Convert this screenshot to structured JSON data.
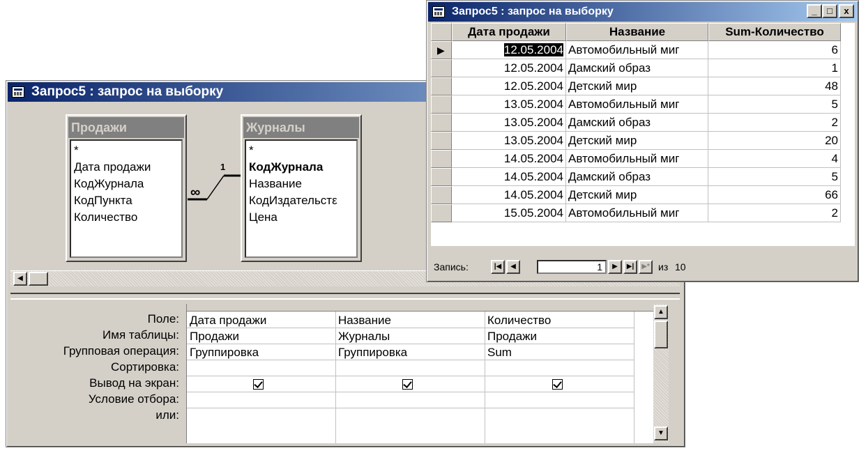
{
  "design_window": {
    "title": "Запрос5 : запрос на выборку",
    "tables": [
      {
        "name": "Продажи",
        "fields": [
          "*",
          "Дата продажи",
          "КодЖурнала",
          "КодПункта",
          "Количество"
        ]
      },
      {
        "name": "Журналы",
        "fields": [
          "*",
          "КодЖурнала",
          "Название",
          "КодИздательстε",
          "Цена"
        ]
      }
    ],
    "relationship": {
      "many": "∞",
      "one": "1"
    },
    "row_labels": {
      "field": "Поле:",
      "table": "Имя таблицы:",
      "group": "Групповая операция:",
      "sort": "Сортировка:",
      "show": "Вывод на экран:",
      "criteria": "Условие отбора:",
      "or": "или:"
    },
    "columns": [
      {
        "field": "Дата продажи",
        "table": "Продажи",
        "group": "Группировка",
        "sort": "",
        "show": true,
        "criteria": "",
        "or": ""
      },
      {
        "field": "Название",
        "table": "Журналы",
        "group": "Группировка",
        "sort": "",
        "show": true,
        "criteria": "",
        "or": ""
      },
      {
        "field": "Количество",
        "table": "Продажи",
        "group": "Sum",
        "sort": "",
        "show": true,
        "criteria": "",
        "or": ""
      }
    ]
  },
  "result_window": {
    "title": "Запрос5 : запрос на выборку",
    "buttons": {
      "minimize": "_",
      "maximize": "□",
      "close": "x"
    },
    "headers": [
      "Дата продажи",
      "Название",
      "Sum-Количество"
    ],
    "rows": [
      [
        "12.05.2004",
        "Автомобильный миг",
        "6"
      ],
      [
        "12.05.2004",
        "Дамский образ",
        "1"
      ],
      [
        "12.05.2004",
        "Детский мир",
        "48"
      ],
      [
        "13.05.2004",
        "Автомобильный миг",
        "5"
      ],
      [
        "13.05.2004",
        "Дамский образ",
        "2"
      ],
      [
        "13.05.2004",
        "Детский мир",
        "20"
      ],
      [
        "14.05.2004",
        "Автомобильный миг",
        "4"
      ],
      [
        "14.05.2004",
        "Дамский образ",
        "5"
      ],
      [
        "14.05.2004",
        "Детский мир",
        "66"
      ],
      [
        "15.05.2004",
        "Автомобильный миг",
        "2"
      ]
    ],
    "nav": {
      "label": "Запись:",
      "current": "1",
      "of_label": "из",
      "total": "10"
    }
  }
}
